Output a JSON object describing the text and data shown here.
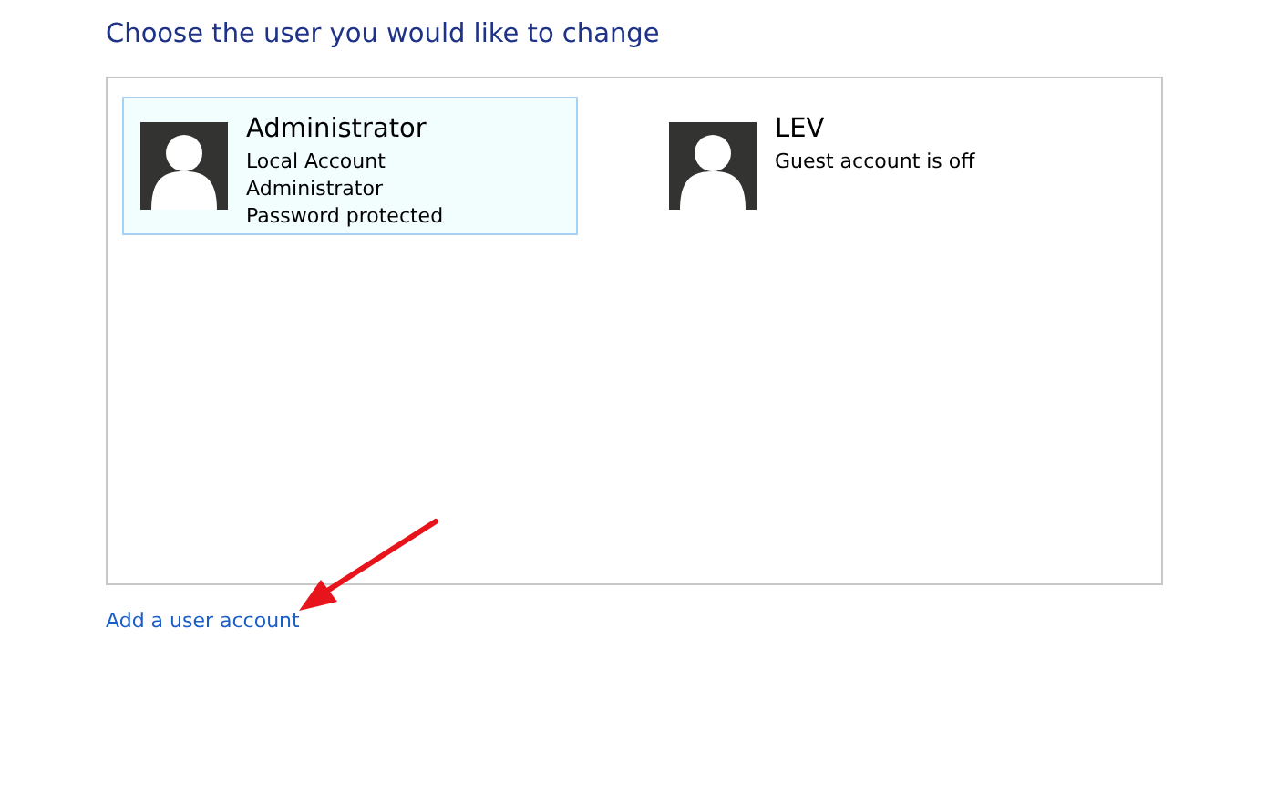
{
  "heading": "Choose the user you would like to change",
  "users": [
    {
      "name": "Administrator",
      "details": [
        "Local Account",
        "Administrator",
        "Password protected"
      ],
      "selected": true
    },
    {
      "name": "LEV",
      "details": [
        "Guest account is off"
      ],
      "selected": false
    }
  ],
  "add_link": "Add a user account"
}
